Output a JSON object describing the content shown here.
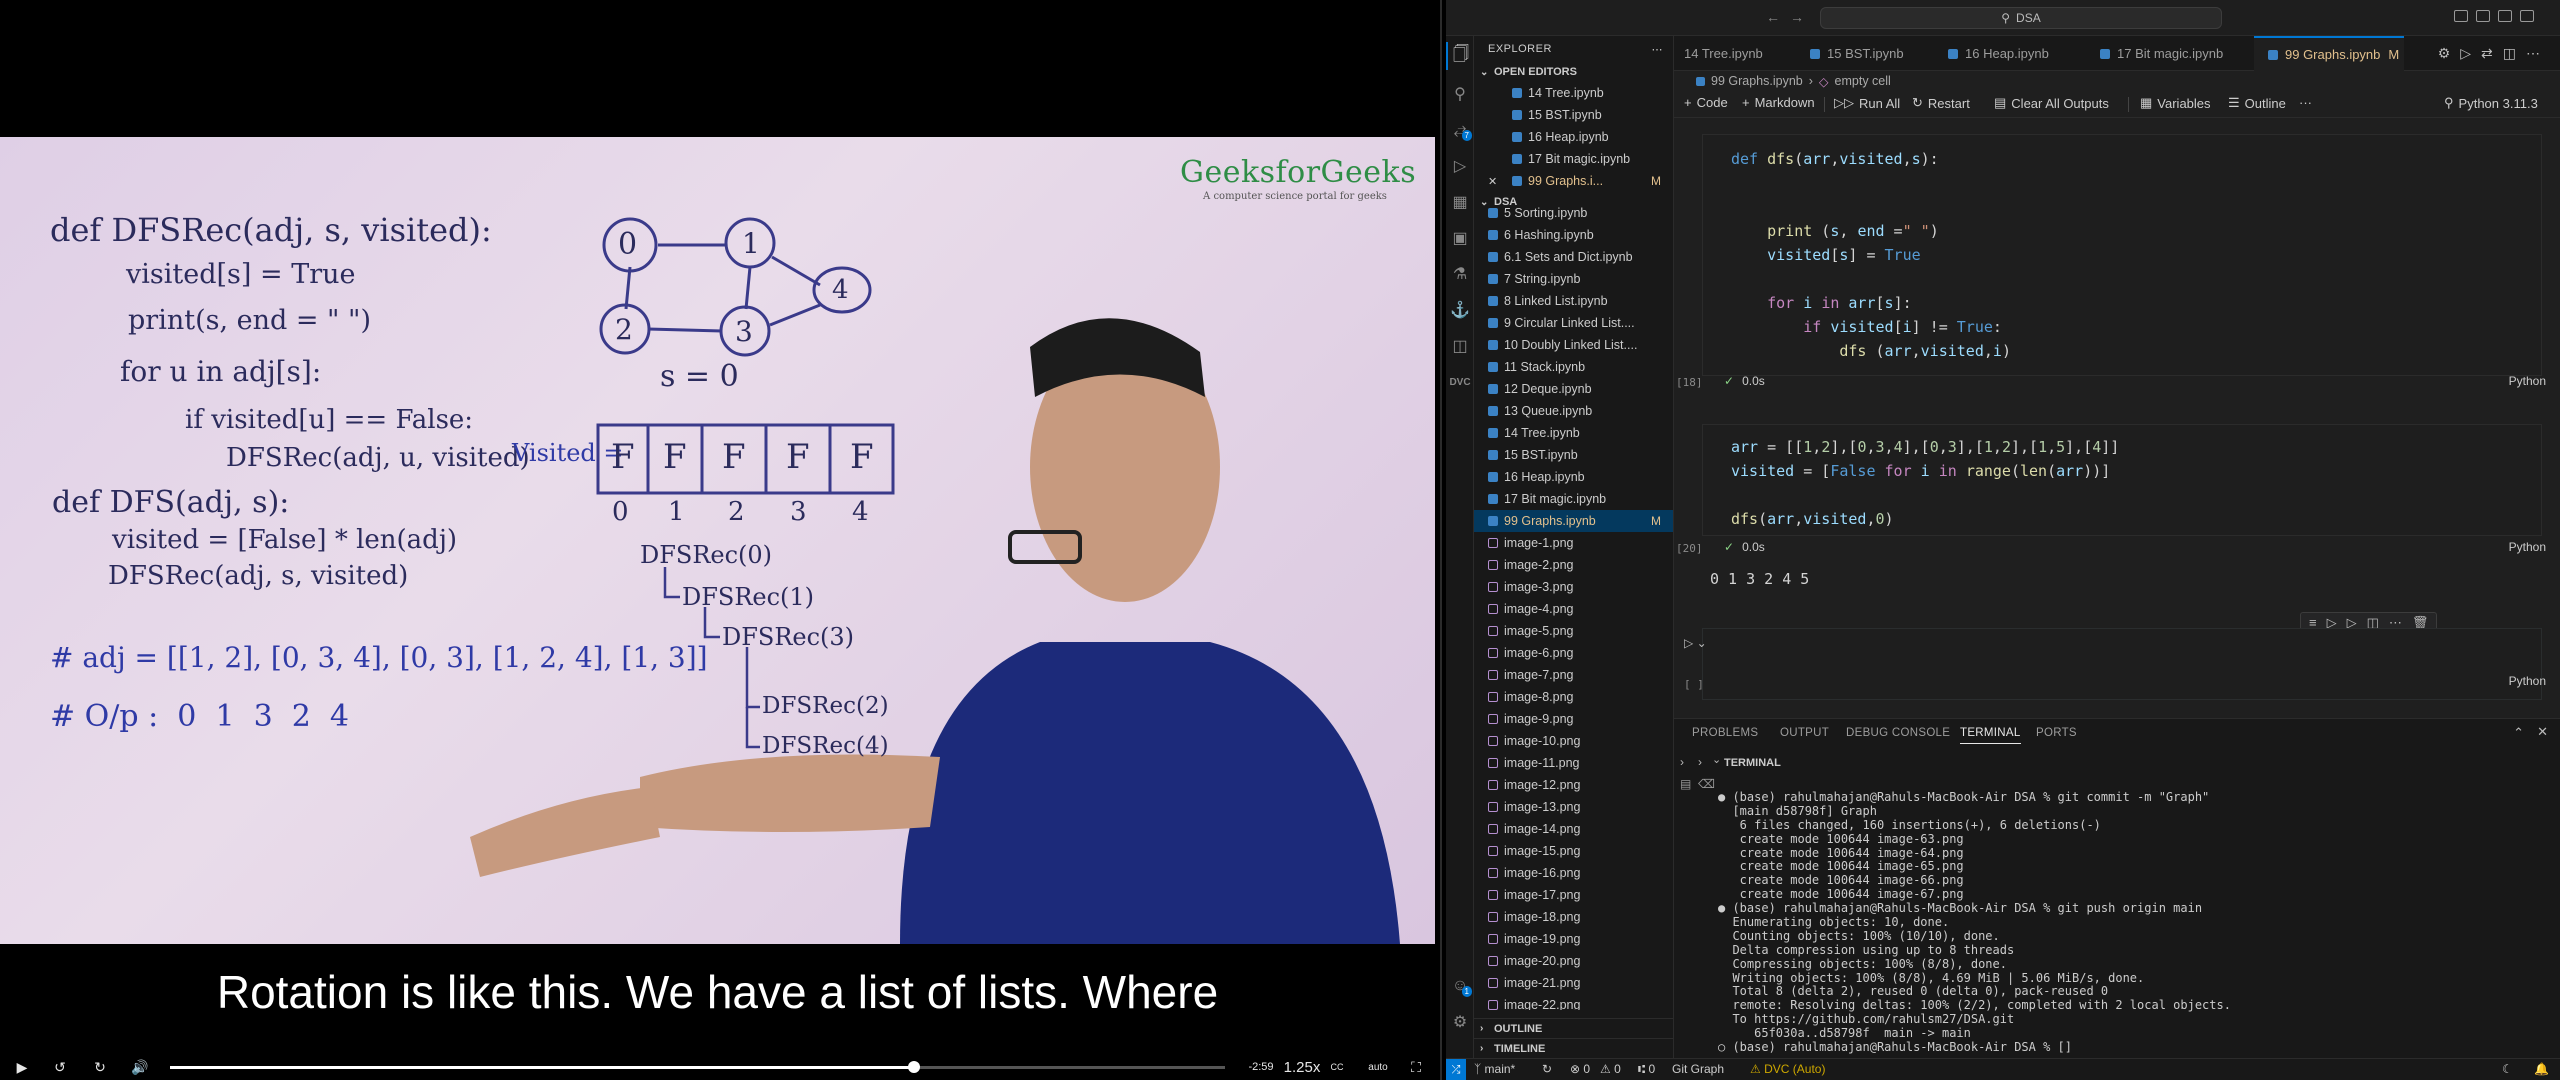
{
  "video": {
    "logo_name": "GeeksforGeeks",
    "logo_tagline": "A computer science portal for geeks",
    "board": {
      "rec_lines": [
        "def DFSRec(adj, s, visited):",
        "visited[s] = True",
        "print(s, end = \" \")",
        "for u in adj[s]:",
        "if visited[u] == False:",
        "DFSRec(adj, u, visited)"
      ],
      "dfs_lines": [
        "def DFS(adj, s):",
        "visited = [False] * len(adj)",
        "DFSRec(adj, s, visited)"
      ],
      "adj_line": "# adj = [[1, 2], [0, 3, 4], [0, 3], [1, 2, 4], [1, 3]]",
      "output_line": "# O/p :  0  1  3  2  4",
      "graph_nodes": [
        "0",
        "1",
        "2",
        "3",
        "4"
      ],
      "source_label": "s = 0",
      "visited_label": "Visited =",
      "visited_cells": [
        "F",
        "F",
        "F",
        "F",
        "F"
      ],
      "visited_index": [
        "0",
        "1",
        "2",
        "3",
        "4"
      ],
      "trace": [
        "DFSRec(0)",
        "DFSRec(1)",
        "DFSRec(3)",
        "DFSRec(2)",
        "DFSRec(4)"
      ]
    },
    "caption": "Rotation is like this. We have a list of lists. Where",
    "controls": {
      "play_icon": "play-icon",
      "time_remaining": "-2:59",
      "speed": "1.25x",
      "cc": "CC",
      "quality": "auto",
      "progress_fraction": 0.705
    }
  },
  "vscode": {
    "search_text": "DSA",
    "activity_badges": {
      "source_control": "7",
      "accounts": "1"
    },
    "explorer": {
      "title": "EXPLORER",
      "open_editors_label": "OPEN EDITORS",
      "open_editors": [
        {
          "name": "14 Tree.ipynb",
          "modified": false
        },
        {
          "name": "15 BST.ipynb",
          "modified": false
        },
        {
          "name": "16 Heap.ipynb",
          "modified": false
        },
        {
          "name": "17 Bit magic.ipynb",
          "modified": false
        },
        {
          "name": "99 Graphs.i...",
          "modified": true,
          "flag": "M"
        }
      ],
      "folder_label": "DSA",
      "files": [
        {
          "name": "5 Sorting.ipynb",
          "type": "nb"
        },
        {
          "name": "6 Hashing.ipynb",
          "type": "nb"
        },
        {
          "name": "6.1 Sets and Dict.ipynb",
          "type": "nb"
        },
        {
          "name": "7 String.ipynb",
          "type": "nb"
        },
        {
          "name": "8 Linked List.ipynb",
          "type": "nb"
        },
        {
          "name": "9 Circular Linked List....",
          "type": "nb"
        },
        {
          "name": "10 Doubly Linked List....",
          "type": "nb"
        },
        {
          "name": "11 Stack.ipynb",
          "type": "nb"
        },
        {
          "name": "12 Deque.ipynb",
          "type": "nb"
        },
        {
          "name": "13 Queue.ipynb",
          "type": "nb"
        },
        {
          "name": "14 Tree.ipynb",
          "type": "nb"
        },
        {
          "name": "15 BST.ipynb",
          "type": "nb"
        },
        {
          "name": "16 Heap.ipynb",
          "type": "nb"
        },
        {
          "name": "17 Bit magic.ipynb",
          "type": "nb"
        },
        {
          "name": "99 Graphs.ipynb",
          "type": "nb",
          "modified": true,
          "flag": "M",
          "selected": true
        },
        {
          "name": "image-1.png",
          "type": "img"
        },
        {
          "name": "image-2.png",
          "type": "img"
        },
        {
          "name": "image-3.png",
          "type": "img"
        },
        {
          "name": "image-4.png",
          "type": "img"
        },
        {
          "name": "image-5.png",
          "type": "img"
        },
        {
          "name": "image-6.png",
          "type": "img"
        },
        {
          "name": "image-7.png",
          "type": "img"
        },
        {
          "name": "image-8.png",
          "type": "img"
        },
        {
          "name": "image-9.png",
          "type": "img"
        },
        {
          "name": "image-10.png",
          "type": "img"
        },
        {
          "name": "image-11.png",
          "type": "img"
        },
        {
          "name": "image-12.png",
          "type": "img"
        },
        {
          "name": "image-13.png",
          "type": "img"
        },
        {
          "name": "image-14.png",
          "type": "img"
        },
        {
          "name": "image-15.png",
          "type": "img"
        },
        {
          "name": "image-16.png",
          "type": "img"
        },
        {
          "name": "image-17.png",
          "type": "img"
        },
        {
          "name": "image-18.png",
          "type": "img"
        },
        {
          "name": "image-19.png",
          "type": "img"
        },
        {
          "name": "image-20.png",
          "type": "img"
        },
        {
          "name": "image-21.png",
          "type": "img"
        },
        {
          "name": "image-22.png",
          "type": "img"
        }
      ],
      "outline_label": "OUTLINE",
      "timeline_label": "TIMELINE"
    },
    "tabs": [
      {
        "name": "14 Tree.ipynb",
        "active": false
      },
      {
        "name": "15 BST.ipynb",
        "active": false
      },
      {
        "name": "16 Heap.ipynb",
        "active": false
      },
      {
        "name": "17 Bit magic.ipynb",
        "active": false
      },
      {
        "name": "99 Graphs.ipynb",
        "active": true,
        "flag": "M"
      }
    ],
    "breadcrumb": [
      "99 Graphs.ipynb",
      "empty cell"
    ],
    "toolbar": {
      "code": "Code",
      "markdown": "Markdown",
      "run_all": "Run All",
      "restart": "Restart",
      "clear_outputs": "Clear All Outputs",
      "variables": "Variables",
      "outline": "Outline",
      "more": "···",
      "kernel": "Python 3.11.3"
    },
    "cells": [
      {
        "exec_count": "[18]",
        "time": "0.0s",
        "lang": "Python"
      },
      {
        "exec_count": "[20]",
        "time": "0.0s",
        "lang": "Python",
        "output": "0 1 3 2 4 5"
      },
      {
        "exec_count": "[ ]",
        "lang": "Python"
      }
    ],
    "panel": {
      "tabs": [
        "PROBLEMS",
        "OUTPUT",
        "DEBUG CONSOLE",
        "TERMINAL",
        "PORTS"
      ],
      "active_tab": "TERMINAL",
      "terminal_title": "TERMINAL",
      "terminal_lines": [
        "● (base) rahulmahajan@Rahuls-MacBook-Air DSA % git commit -m \"Graph\"",
        "  [main d58798f] Graph",
        "   6 files changed, 160 insertions(+), 6 deletions(-)",
        "   create mode 100644 image-63.png",
        "   create mode 100644 image-64.png",
        "   create mode 100644 image-65.png",
        "   create mode 100644 image-66.png",
        "   create mode 100644 image-67.png",
        "● (base) rahulmahajan@Rahuls-MacBook-Air DSA % git push origin main",
        "  Enumerating objects: 10, done.",
        "  Counting objects: 100% (10/10), done.",
        "  Delta compression using up to 8 threads",
        "  Compressing objects: 100% (8/8), done.",
        "  Writing objects: 100% (8/8), 4.69 MiB | 5.06 MiB/s, done.",
        "  Total 8 (delta 2), reused 0 (delta 0), pack-reused 0",
        "  remote: Resolving deltas: 100% (2/2), completed with 2 local objects.",
        "  To https://github.com/rahulsm27/DSA.git",
        "     65f030a..d58798f  main -> main",
        "○ (base) rahulmahajan@Rahuls-MacBook-Air DSA % []"
      ]
    },
    "statusbar": {
      "branch": "main*",
      "errors": "⊗ 0",
      "warnings": "⚠ 0",
      "ports": "⑆ 0",
      "git_graph": "Git Graph",
      "dvc": "DVC (Auto)"
    }
  }
}
